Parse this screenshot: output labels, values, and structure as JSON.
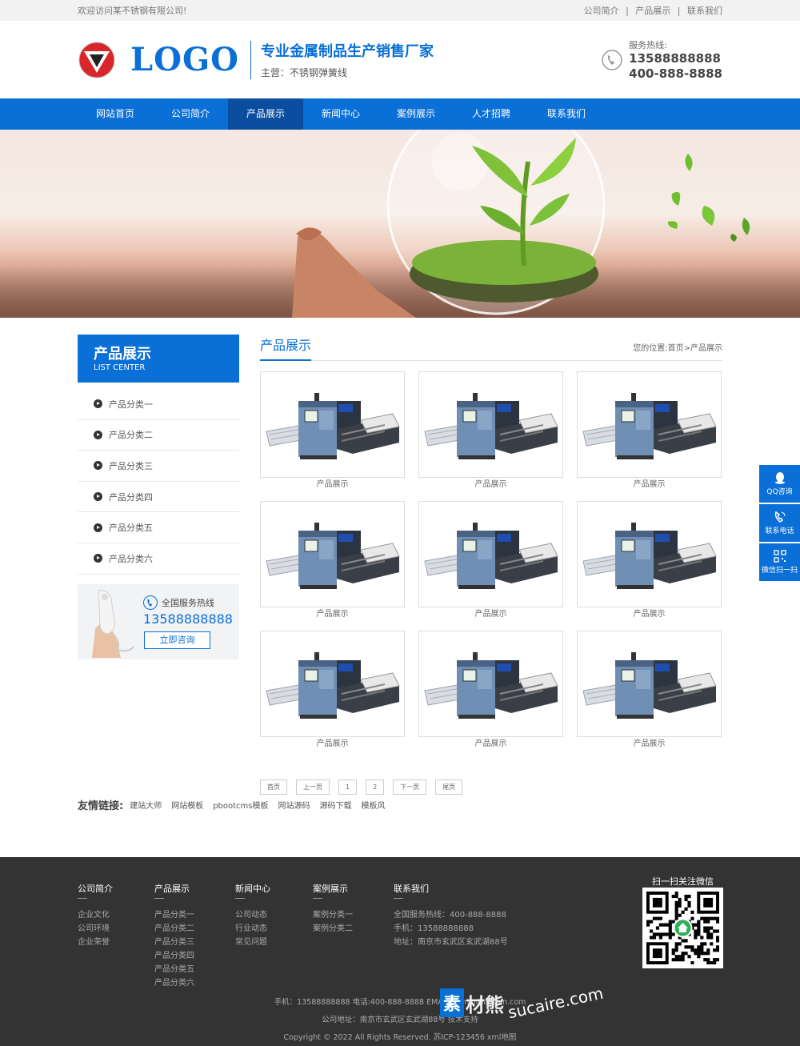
{
  "topbar": {
    "welcome": "欢迎访问某不锈钢有限公司!",
    "links": [
      "公司简介",
      "产品展示",
      "联系我们"
    ],
    "sep": "|"
  },
  "header": {
    "logo_text": "LOGO",
    "slogan_main": "专业金属制品生产销售厂家",
    "slogan_sub": "主营：不锈钢弹簧线",
    "hotline_label": "服务热线:",
    "hotline_1": "13588888888",
    "hotline_2": "400-888-8888"
  },
  "nav": {
    "items": [
      "网站首页",
      "公司简介",
      "产品展示",
      "新闻中心",
      "案例展示",
      "人才招聘",
      "联系我们"
    ],
    "active_index": 2
  },
  "sidebar": {
    "title": "产品展示",
    "subtitle": "LIST CENTER",
    "items": [
      "产品分类一",
      "产品分类二",
      "产品分类三",
      "产品分类四",
      "产品分类五",
      "产品分类六"
    ],
    "contact_title": "全国服务热线",
    "contact_number": "13588888888",
    "contact_button": "立即咨询"
  },
  "content": {
    "title": "产品展示",
    "breadcrumb": "您的位置:首页>产品展示",
    "products": [
      "产品展示",
      "产品展示",
      "产品展示",
      "产品展示",
      "产品展示",
      "产品展示",
      "产品展示",
      "产品展示",
      "产品展示"
    ],
    "pager": [
      "首页",
      "上一页",
      "1",
      "2",
      "下一页",
      "尾页"
    ]
  },
  "friends": {
    "label": "友情链接:",
    "links": [
      "建站大师",
      "网站模板",
      "pbootcms模板",
      "网站源码",
      "源码下载",
      "模板风"
    ]
  },
  "footer": {
    "columns": [
      {
        "title": "公司简介",
        "items": [
          "企业文化",
          "公司环境",
          "企业荣誉"
        ]
      },
      {
        "title": "产品展示",
        "items": [
          "产品分类一",
          "产品分类二",
          "产品分类三",
          "产品分类四",
          "产品分类五",
          "产品分类六"
        ]
      },
      {
        "title": "新闻中心",
        "items": [
          "公司动态",
          "行业动态",
          "常见问题"
        ]
      },
      {
        "title": "案例展示",
        "items": [
          "案例分类一",
          "案例分类二"
        ]
      },
      {
        "title": "联系我们",
        "items": [
          "全国服务热线：400-888-8888",
          "手机：13588888888",
          "地址：南京市玄武区玄武湖88号"
        ]
      }
    ],
    "qr_title": "扫一扫关注微信",
    "line_1": "手机：13588888888 电话:400-888-8888 EMAIL:admin@admin.com",
    "line_2": "公司地址：南京市玄武区玄武湖88号 技术支持",
    "line_3": "Copyright © 2022 All Rights Reserved. 苏ICP-123456 xml地图"
  },
  "float": {
    "items": [
      "QQ咨询",
      "联系电话",
      "微信扫一扫"
    ]
  },
  "watermark": {
    "box": "素",
    "text": "材熊",
    "url": "sucaire.com"
  },
  "colors": {
    "brand_blue": "#0a6fd6",
    "nav_active": "#0b4ea0",
    "footer_bg": "#333333"
  }
}
